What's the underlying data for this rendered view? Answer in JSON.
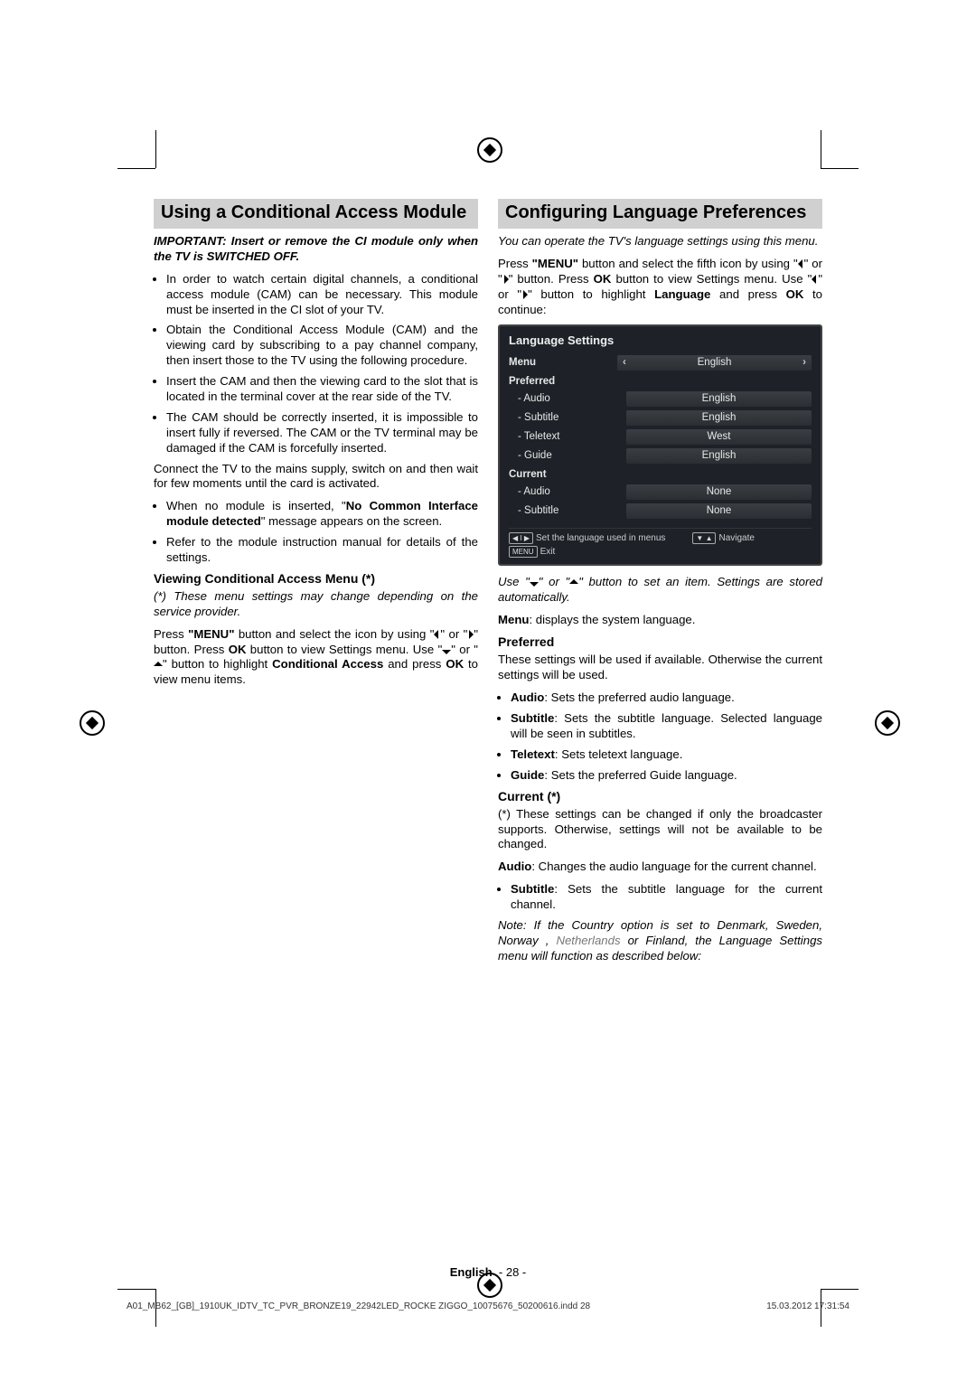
{
  "colA": {
    "heading": "Using a Conditional Access Module",
    "important": "IMPORTANT: Insert or remove the CI module only when the TV is SWITCHED OFF.",
    "bullets1": [
      "In order to watch certain digital channels, a conditional access module (CAM) can be necessary. This module must be inserted in the CI slot of your TV.",
      "Obtain the Conditional Access Module (CAM) and the viewing card by subscribing to a pay channel company, then insert those to the TV using the following procedure.",
      "Insert the CAM and then the viewing card to the slot that is located in the terminal cover at the rear side of the TV.",
      "The CAM should be correctly inserted, it is impossible to insert fully if reversed. The CAM or the TV terminal may be damaged if the CAM is forcefully inserted."
    ],
    "connect": "Connect the TV to the mains supply, switch on and then wait for few moments until the card is activated.",
    "noModule": {
      "pre": "When no module is inserted, \"",
      "bold": "No Common Interface module detected",
      "post": "\" message appears on the screen."
    },
    "refer": "Refer to the module instruction manual for details of the settings.",
    "viewingHead": "Viewing Conditional Access Menu (*)",
    "viewingNote": "(*) These menu settings may change depending on the service provider.",
    "press": {
      "a": "Press ",
      "menu": "\"MENU\"",
      "b": " button and select the icon by using \"",
      "c": "\" or \"",
      "d": "\" button. Press ",
      "ok": "OK",
      "e": " button to view Settings menu. Use \"",
      "f": "\" or \"",
      "g": "\" button to highlight ",
      "ca": "Conditional Access",
      "h": " and press ",
      "i": " to view menu items."
    }
  },
  "colB": {
    "heading": "Configuring Language Preferences",
    "intro": "You can operate the TV's language settings using this menu.",
    "press": {
      "a": "Press ",
      "menu": "\"MENU\"",
      "b": " button and select the fifth icon by using \"",
      "c": "\" or \"",
      "d": "\" button. Press ",
      "ok": "OK",
      "e": " button to view Settings menu. Use \"",
      "f": "\" or \"",
      "g": "\" button to highlight ",
      "lang": "Language",
      "h": " and press ",
      "i": " to continue:"
    },
    "osd": {
      "title": "Language Settings",
      "menuLabel": "Menu",
      "menuVal": "English",
      "prefLabel": "Preferred",
      "rows_pref": [
        {
          "label": "- Audio",
          "val": "English"
        },
        {
          "label": "- Subtitle",
          "val": "English"
        },
        {
          "label": "- Teletext",
          "val": "West"
        },
        {
          "label": "- Guide",
          "val": "English"
        }
      ],
      "curLabel": "Current",
      "rows_cur": [
        {
          "label": "- Audio",
          "val": "None"
        },
        {
          "label": "- Subtitle",
          "val": "None"
        }
      ],
      "foot_set": "Set the language used in menus",
      "foot_nav": "Navigate",
      "foot_exit": "Exit",
      "key_arrows": "◀ I ▶",
      "key_menu": "MENU",
      "key_nav": "▼ ▲"
    },
    "useArrows": {
      "a": "Use \"",
      "b": "\" or \"",
      "c": "\" button to set an item. Settings are stored automatically."
    },
    "menuDesc": {
      "b": "Menu",
      "t": ": displays the system language."
    },
    "prefHead": "Preferred",
    "prefIntro": "These settings will be used if available. Otherwise the current settings will be used.",
    "prefBullets": [
      {
        "b": "Audio",
        "t": ": Sets the preferred audio language."
      },
      {
        "b": "Subtitle",
        "t": ": Sets the subtitle language. Selected language will be seen in subtitles."
      },
      {
        "b": "Teletext",
        "t": ": Sets teletext language."
      },
      {
        "b": "Guide",
        "t": ": Sets the preferred Guide language."
      }
    ],
    "curHead": "Current (*)",
    "curNote": "(*) These settings can be changed if only the broadcaster supports. Otherwise, settings will not be available to be changed.",
    "curAudio": {
      "b": "Audio",
      "t": ": Changes the audio language for the current channel."
    },
    "curSub": {
      "b": "Subtitle",
      "t": ": Sets the subtitle language for the current channel."
    },
    "note": {
      "a": "Note: If the Country option is set to Denmark, Sweden, Norway , ",
      "grey": "Netherlands",
      "b": " or Finland, the Language Settings menu will function as described below:"
    }
  },
  "footer": {
    "lang": "English",
    "page": "- 28 -"
  },
  "meta": {
    "file": "A01_MB62_[GB]_1910UK_IDTV_TC_PVR_BRONZE19_22942LED_ROCKE   ZIGGO_10075676_50200616.indd   28",
    "date": "15.03.2012   17:31:54"
  }
}
